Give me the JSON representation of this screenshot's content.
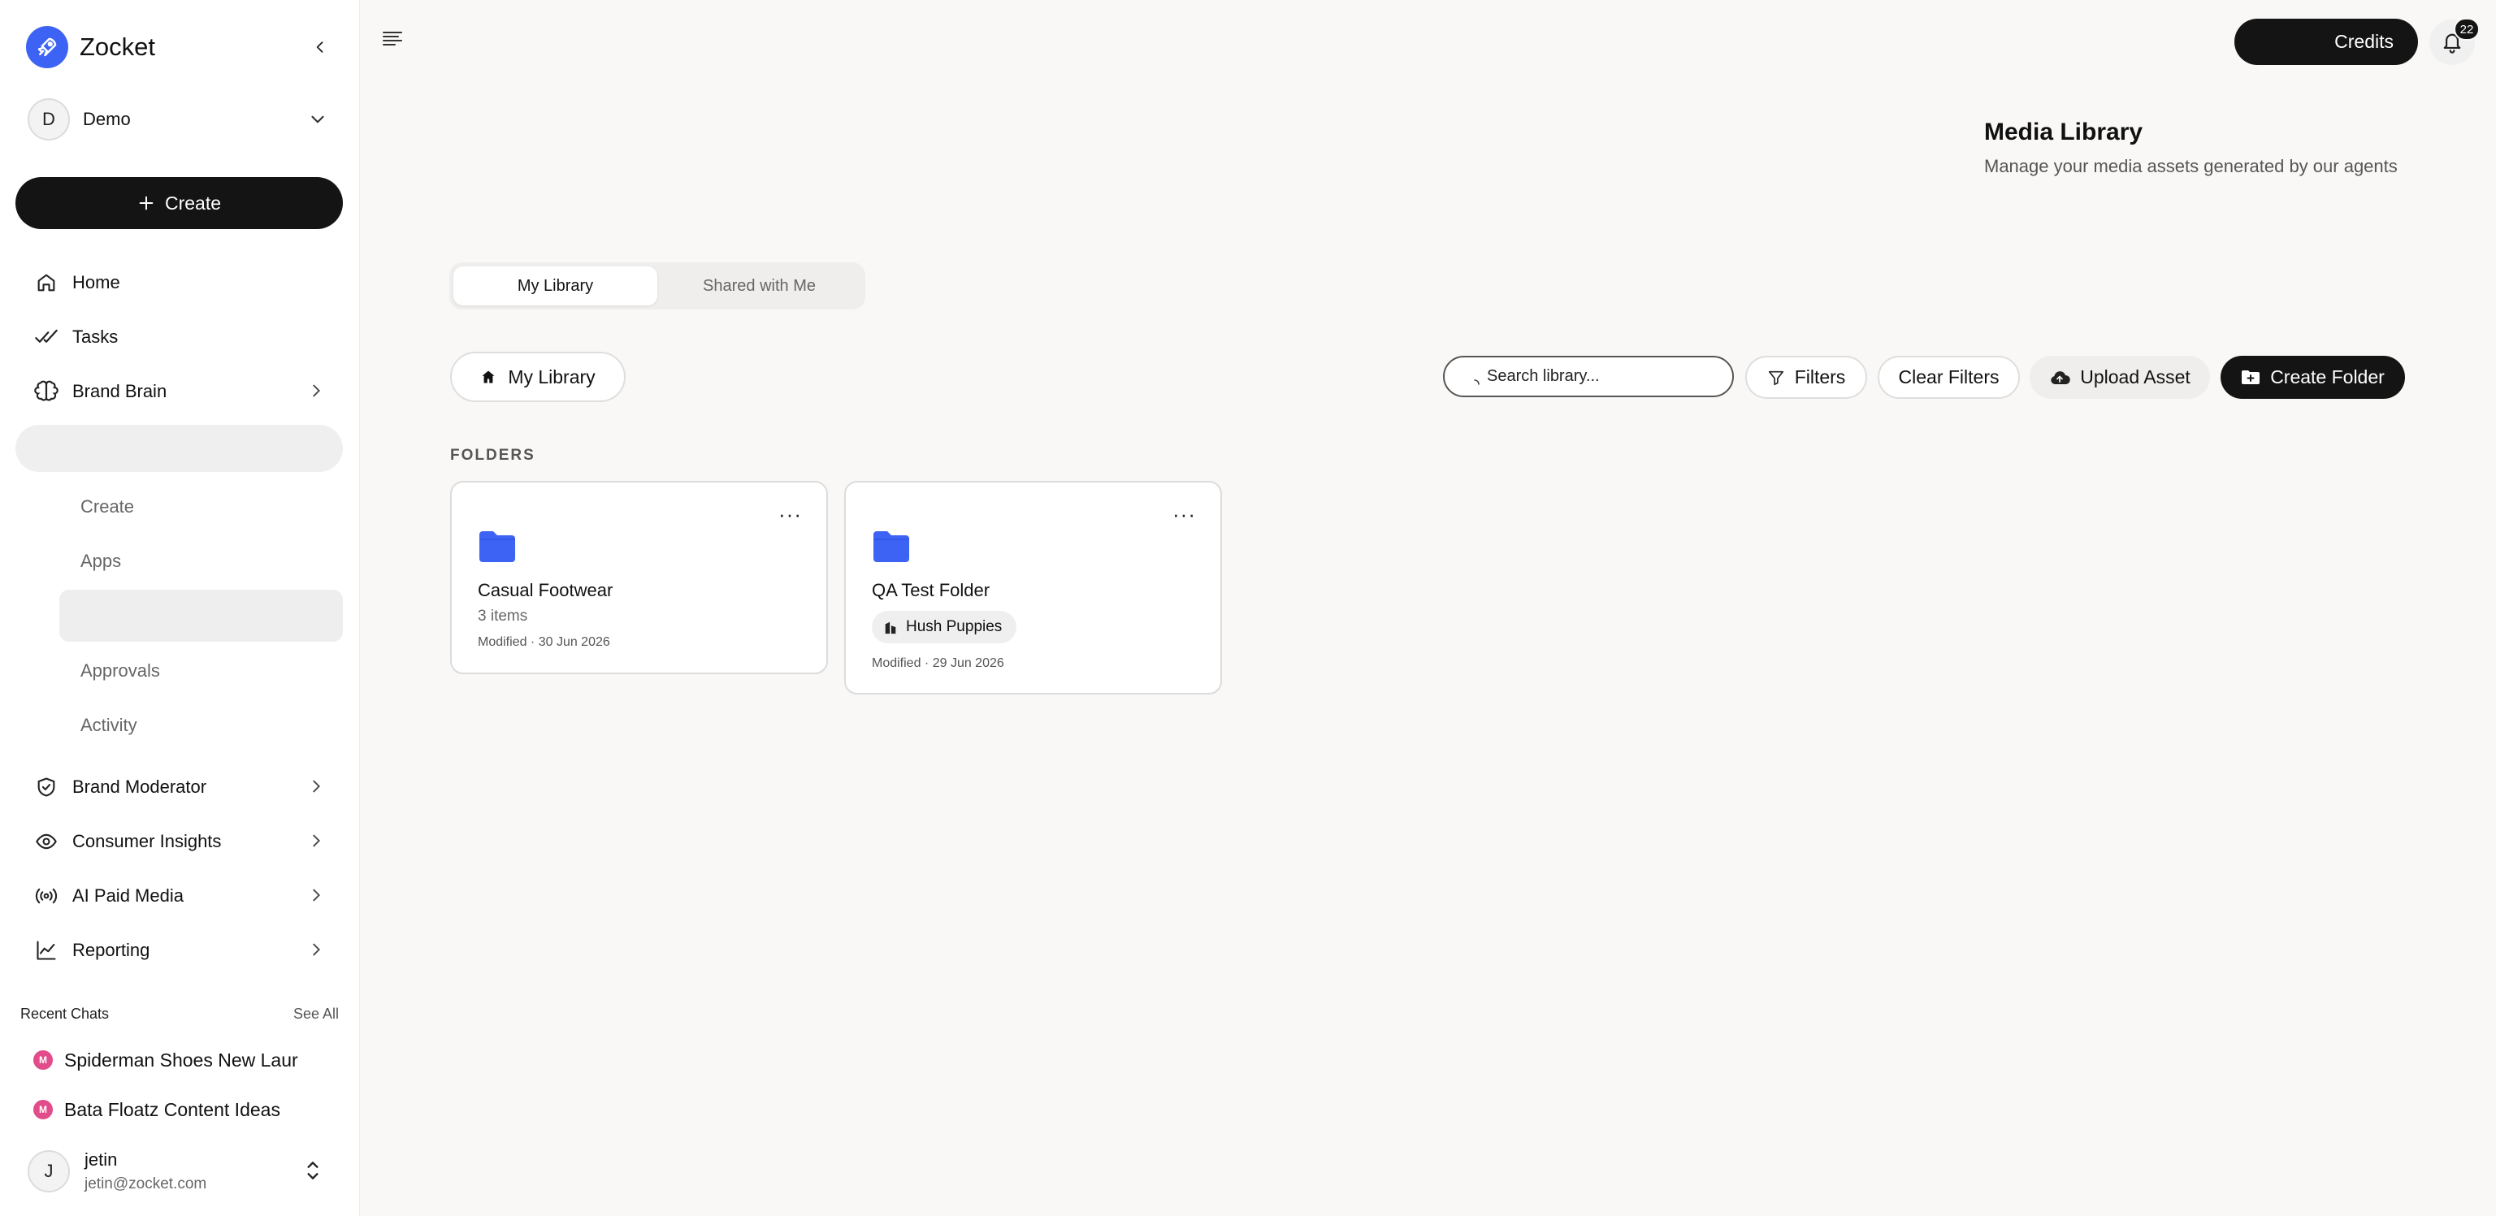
{
  "app": {
    "name": "Zocket"
  },
  "workspace": {
    "initial": "D",
    "name": "Demo"
  },
  "sidebar": {
    "create_label": "Create",
    "nav": [
      {
        "label": "Home",
        "icon": "home-icon"
      },
      {
        "label": "Tasks",
        "icon": "double-check-icon"
      },
      {
        "label": "Brand Brain",
        "icon": "brain-icon"
      },
      {
        "label": "Brand Moderator",
        "icon": "shield-check-icon"
      },
      {
        "label": "Consumer Insights",
        "icon": "eye-icon"
      },
      {
        "label": "AI Paid Media",
        "icon": "broadcast-icon"
      },
      {
        "label": "Reporting",
        "icon": "line-chart-icon"
      }
    ],
    "sub_items": [
      "Create",
      "Apps",
      "Approvals",
      "Activity"
    ],
    "recent_chats": {
      "title": "Recent Chats",
      "see_all": "See All",
      "items": [
        {
          "badge": "M",
          "label": "Spiderman Shoes New Laur"
        },
        {
          "badge": "M",
          "label": "Bata Floatz Content Ideas"
        }
      ]
    },
    "user": {
      "initial": "J",
      "name": "jetin",
      "email": "jetin@zocket.com"
    }
  },
  "topbar": {
    "credits_label": "Credits",
    "notification_count": "22"
  },
  "page": {
    "title": "Media Library",
    "subtitle": "Manage your media assets generated by our agents",
    "tabs": [
      {
        "label": "My Library",
        "active": true
      },
      {
        "label": "Shared with Me",
        "active": false
      }
    ],
    "breadcrumb": "My Library",
    "toolbar": {
      "search_placeholder": "Search library...",
      "filters_label": "Filters",
      "clear_filters_label": "Clear Filters",
      "upload_label": "Upload Asset",
      "create_folder_label": "Create Folder"
    },
    "folders_heading": "FOLDERS",
    "folders": [
      {
        "name": "Casual Footwear",
        "count": "3 items",
        "modified": "Modified · 30 Jun 2026"
      },
      {
        "name": "QA Test Folder",
        "tag": "Hush Puppies",
        "modified": "Modified · 29 Jun 2026"
      }
    ]
  },
  "colors": {
    "accent": "#3d63f4",
    "dark": "#141414",
    "chat_badge": "#e24c8b"
  }
}
